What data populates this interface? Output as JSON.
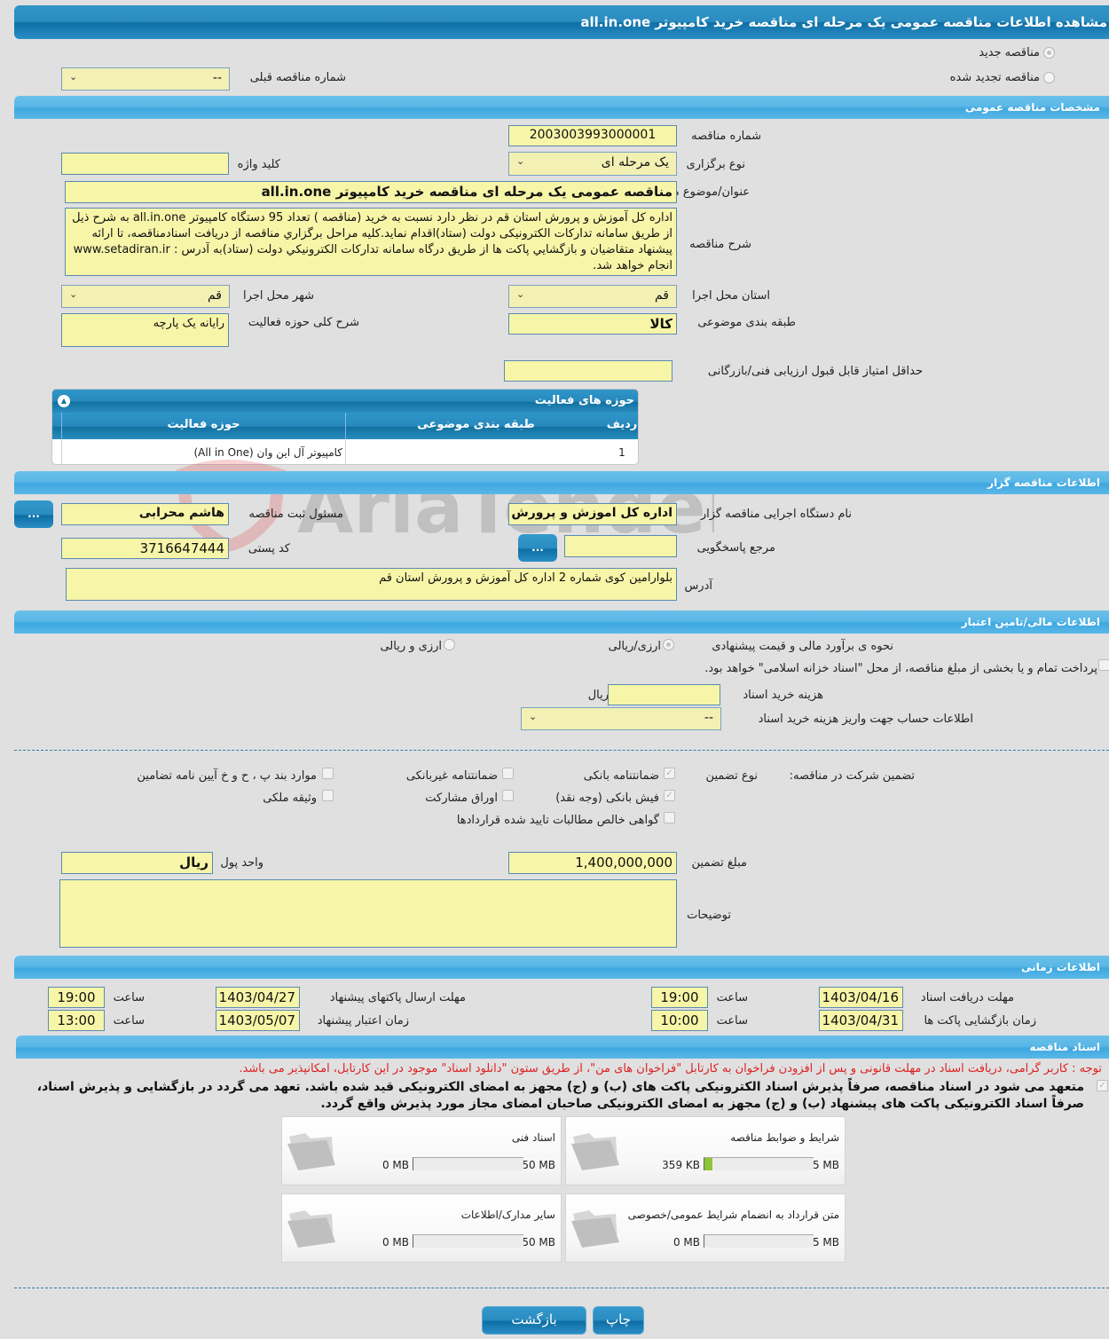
{
  "page": {
    "title": "مشاهده اطلاعات مناقصه عمومی یک مرحله ای مناقصه خرید کامپیوتر all.in.one"
  },
  "tender_type": {
    "options": [
      {
        "label": "مناقصه جدید",
        "checked": true
      },
      {
        "label": "مناقصه تجدید شده",
        "checked": false
      }
    ],
    "previous_number_label": "شماره مناقصه قبلی",
    "previous_number_value": "--"
  },
  "general": {
    "section_title": "مشخصات مناقصه عمومی",
    "number_label": "شماره مناقصه",
    "number_value": "2003003993000001",
    "keyword_label": "کلید واژه",
    "keyword_value": "",
    "holding_type_label": "نوع برگزاری",
    "holding_type_value": "یک مرحله ای",
    "subject_label": "عنوان/موضوع مناقصه",
    "subject_value": "مناقصه عمومی یک مرحله ای مناقصه خرید کامپیوتر all.in.one",
    "description_label": "شرح مناقصه",
    "description_value": "اداره کل آموزش و پرورش استان قم در نظر دارد نسبت به خرید (مناقصه ) تعداد 95 دستگاه کامپیوتر all.in.one به شرح ذیل  از طریق سامانه تدارکات الکترونیکی دولت (ستاد)اقدام نماید.کلیه مراحل برگزاري مناقصه  از دریافت اسنادمناقصه، تا ارائه پیشنهاد متقاضیان و بازگشايي پاکت ها از طریق درگاه سامانه تدارکات الكترونيكي دولت (ستاد)به آدرس : www.setadiran.ir انجام خواهد شد.",
    "province_label": "استان محل اجرا",
    "province_value": "قم",
    "city_label": "شهر محل اجرا",
    "city_value": "قم",
    "category_label": "طبقه بندی موضوعی",
    "category_value": "کالا",
    "activity_desc_label": "شرح کلی حوزه فعالیت",
    "activity_desc_value": "رایانه یک پارچه",
    "min_score_label": "حداقل امتیاز قابل قبول ارزیابی فنی/بازرگانی",
    "min_score_value": ""
  },
  "activities": {
    "title": "حوزه های فعالیت",
    "columns": [
      "ردیف",
      "طبقه بندی موضوعی",
      "حوزه فعالیت"
    ],
    "rows": [
      {
        "row": "1",
        "category": "",
        "activity": "کامپیوتر آل این وان (All in One)"
      }
    ]
  },
  "watermark": "AriaTender.neT",
  "organizer": {
    "section_title": "اطلاعات مناقصه گزار",
    "org_name_label": "نام دستگاه اجرایی مناقصه گزار",
    "org_name_value": "اداره کل اموزش و پرورش اس",
    "registrar_label": "مسئول ثبت مناقصه",
    "registrar_value": "هاشم محرابی",
    "reference_label": "مرجع پاسخگویی",
    "reference_value": "",
    "postal_label": "کد پستی",
    "postal_value": "3716647444",
    "address_label": "آدرس",
    "address_value": "بلوارامین کوی شماره 2 اداره کل آموزش و پرورش استان قم",
    "dots_label": "..."
  },
  "finance": {
    "section_title": "اطلاعات مالی/تامین اعتبار",
    "estimate_label": "نحوه ی برآورد مالی و قیمت پیشنهادی",
    "estimate_options": [
      {
        "label": "ارزی/ریالی",
        "checked": true
      },
      {
        "label": "ارزی و ریالی",
        "checked": false
      }
    ],
    "treasury_label": "پرداخت تمام و یا بخشی از مبلغ مناقصه، از محل \"اسناد خزانه اسلامی\" خواهد بود.",
    "treasury_checked": false,
    "doc_fee_label": "هزینه خرید اسناد",
    "doc_fee_value": "",
    "doc_fee_unit": "ریال",
    "account_label": "اطلاعات حساب جهت واریز هزینه خرید اسناد",
    "account_value": "--"
  },
  "guarantee": {
    "label": "تضمین شرکت در مناقصه:",
    "type_label": "نوع تضمین",
    "options": [
      {
        "label": "ضمانتنامه بانکی",
        "checked": true
      },
      {
        "label": "ضمانتنامه غیربانکی",
        "checked": false
      },
      {
        "label": "موارد بند پ ، ح و خ آیین نامه تضامین",
        "checked": false
      },
      {
        "label": "فیش بانکی (وجه نقد)",
        "checked": true
      },
      {
        "label": "اوراق مشارکت",
        "checked": false
      },
      {
        "label": "وثیقه ملکی",
        "checked": false
      },
      {
        "label": "گواهی خالص مطالبات تایید شده قراردادها",
        "checked": false
      }
    ],
    "amount_label": "مبلغ تضمین",
    "amount_value": "1,400,000,000",
    "currency_label": "واحد پول",
    "currency_value": "ریال",
    "notes_label": "توضیحات",
    "notes_value": ""
  },
  "timing": {
    "section_title": "اطلاعات زمانی",
    "hour_label": "ساعت",
    "items": [
      {
        "label": "مهلت دریافت اسناد",
        "date": "1403/04/16",
        "time": "19:00"
      },
      {
        "label": "مهلت ارسال پاکتهای پیشنهاد",
        "date": "1403/04/27",
        "time": "19:00"
      },
      {
        "label": "زمان بازگشایی پاکت ها",
        "date": "1403/04/31",
        "time": "10:00"
      },
      {
        "label": "زمان اعتبار پیشنهاد",
        "date": "1403/05/07",
        "time": "13:00"
      }
    ]
  },
  "documents": {
    "section_title": "اسناد مناقصه",
    "notice": "توجه : کاربر گرامی، دریافت اسناد در مهلت قانونی و پس از افزودن فراخوان به کارتابل \"فراخوان های من\"، از طریق ستون \"دانلود اسناد\" موجود در این کارتابل، امکانپذیر می باشد.",
    "commitment": "متعهد می شود در اسناد مناقصه، صرفاً پذیرش اسناد الکترونیکی پاکت های (ب) و (ج) مجهز به امضای الکترونیکی قید شده باشد. تعهد می گردد در بازگشایی و پذیرش اسناد، صرفاً اسناد الکترونیکی پاکت های پیشنهاد (ب) و (ج) مجهز به امضای الکترونیکی صاحبان امضای مجاز مورد پذیرش واقع گردد.",
    "commitment_checked": true,
    "items": [
      {
        "title": "شرایط و ضوابط مناقصه",
        "current": "359 KB",
        "max": "5 MB",
        "fill": 0.07
      },
      {
        "title": "اسناد فنی",
        "current": "0 MB",
        "max": "50 MB",
        "fill": 0
      },
      {
        "title": "متن قرارداد به انضمام شرایط عمومی/خصوصی",
        "current": "0 MB",
        "max": "5 MB",
        "fill": 0
      },
      {
        "title": "سایر مدارک/اطلاعات",
        "current": "0 MB",
        "max": "50 MB",
        "fill": 0
      }
    ]
  },
  "footer": {
    "print_label": "چاپ",
    "back_label": "بازگشت"
  }
}
